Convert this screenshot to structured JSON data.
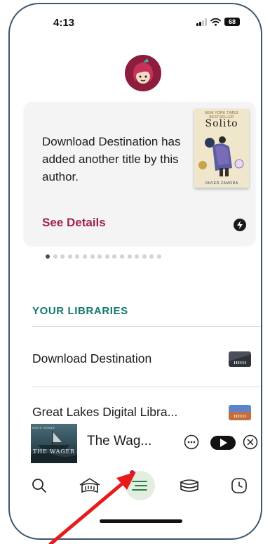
{
  "status_bar": {
    "time": "4:13",
    "battery": "68"
  },
  "promo": {
    "message": "Download Destination has added another title by this author.",
    "action_label": "See Details",
    "book": {
      "tag": "NEW YORK TIMES BESTSELLER",
      "title": "Solito",
      "author": "JAVIER ZAMORA"
    }
  },
  "carousel": {
    "total_pages": 16,
    "active_index": 0
  },
  "libraries": {
    "heading": "YOUR LIBRARIES",
    "items": [
      {
        "name": "Download Destination",
        "card_color": "#4a4f59"
      },
      {
        "name": "Great Lakes Digital Libra...",
        "card_color": "#c46e3d"
      }
    ]
  },
  "now_playing": {
    "title": "The Wag...",
    "cover_author": "DAVID GRANN",
    "cover_title": "THE WAGER"
  },
  "tabs": [
    {
      "name": "search",
      "icon": "search-icon"
    },
    {
      "name": "libraries",
      "icon": "library-icon"
    },
    {
      "name": "menu",
      "icon": "menu-lines-icon",
      "active": true
    },
    {
      "name": "shelf",
      "icon": "shelf-books-icon"
    },
    {
      "name": "activity",
      "icon": "clock-icon"
    }
  ],
  "colors": {
    "accent": "#a3224b",
    "heading": "#13796f",
    "frame": "#3f566d",
    "annotation": "#e61b1b"
  }
}
